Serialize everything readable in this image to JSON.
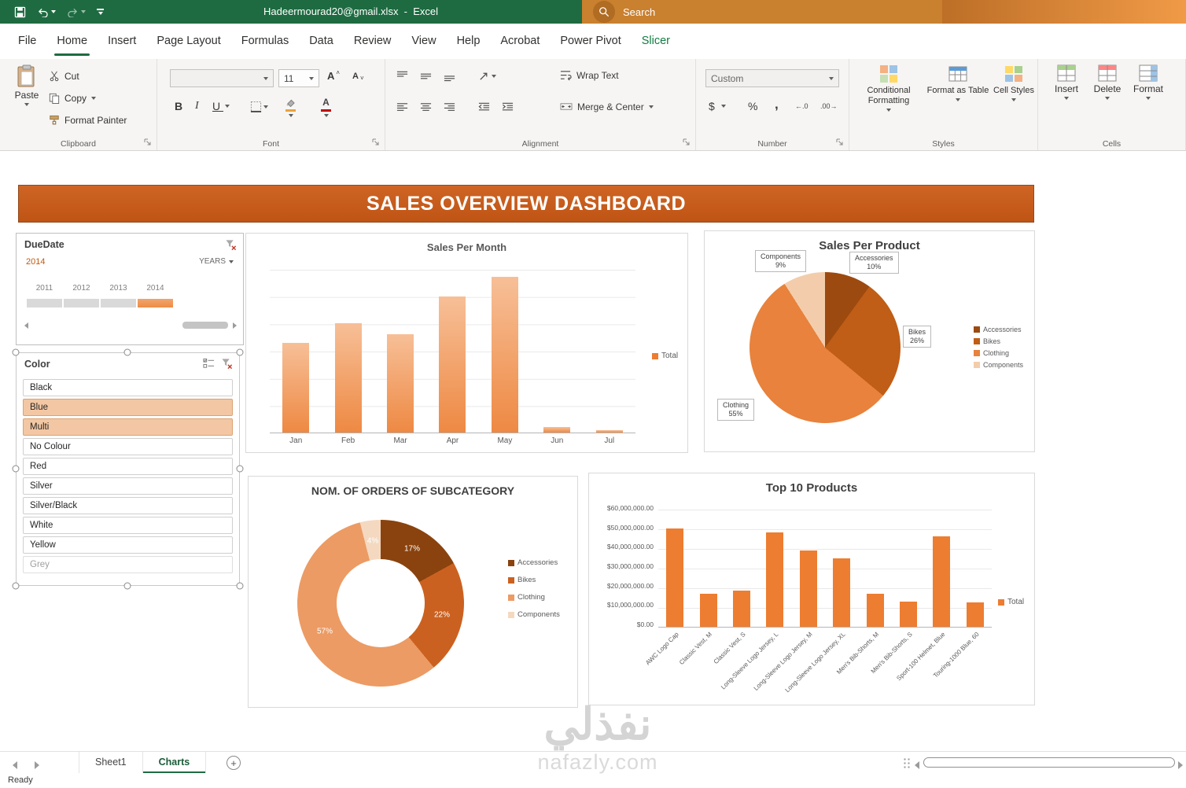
{
  "titlebar": {
    "filename": "Hadeermourad20@gmail.xlsx  -  Excel",
    "search_placeholder": "Search"
  },
  "ribbon": {
    "tabs": [
      "File",
      "Home",
      "Insert",
      "Page Layout",
      "Formulas",
      "Data",
      "Review",
      "View",
      "Help",
      "Acrobat",
      "Power Pivot",
      "Slicer"
    ],
    "active_tab": "Home",
    "contextual_tabs": [
      "Slicer"
    ],
    "clipboard": {
      "group_label": "Clipboard",
      "paste": "Paste",
      "cut": "Cut",
      "copy": "Copy",
      "format_painter": "Format Painter"
    },
    "font": {
      "group_label": "Font",
      "font_name": "",
      "font_size": "11"
    },
    "alignment": {
      "group_label": "Alignment",
      "wrap_text": "Wrap Text",
      "merge_center": "Merge & Center"
    },
    "number": {
      "group_label": "Number",
      "format": "Custom",
      "increase_decimal": "←.0",
      "decrease_decimal": ".00→"
    },
    "styles": {
      "group_label": "Styles",
      "conditional": "Conditional Formatting",
      "format_table": "Format as Table",
      "cell_styles": "Cell Styles"
    },
    "cells": {
      "group_label": "Cells",
      "insert": "Insert",
      "delete": "Delete",
      "format": "Format"
    }
  },
  "dashboard_title": "SALES OVERVIEW DASHBOARD",
  "timeline": {
    "title": "DueDate",
    "selection": "2014",
    "period_selector": "YEARS",
    "years": [
      "2011",
      "2012",
      "2013",
      "2014"
    ],
    "selected_year": "2014"
  },
  "color_slicer": {
    "title": "Color",
    "items": [
      {
        "label": "Black",
        "state": "normal"
      },
      {
        "label": "Blue",
        "state": "selected"
      },
      {
        "label": "Multi",
        "state": "selected"
      },
      {
        "label": "No Colour",
        "state": "normal"
      },
      {
        "label": "Red",
        "state": "normal"
      },
      {
        "label": "Silver",
        "state": "normal"
      },
      {
        "label": "Silver/Black",
        "state": "normal"
      },
      {
        "label": "White",
        "state": "normal"
      },
      {
        "label": "Yellow",
        "state": "normal"
      },
      {
        "label": "Grey",
        "state": "disabled"
      }
    ]
  },
  "chart_data": [
    {
      "type": "bar",
      "title": "Sales Per Month",
      "categories": [
        "Jan",
        "Feb",
        "Mar",
        "Apr",
        "May",
        "Jun",
        "Jul"
      ],
      "series": [
        {
          "name": "Total",
          "values": [
            33,
            40,
            36,
            50,
            57,
            2,
            1
          ]
        }
      ],
      "ylim": [
        0,
        60
      ],
      "grid": true,
      "legend": [
        "Total"
      ],
      "legend_position": "right",
      "bar_color": "#ed7d31",
      "note": "y-axis has gridlines but no visible tick labels"
    },
    {
      "type": "pie",
      "title": "Sales Per Product",
      "labels": [
        "Accessories",
        "Bikes",
        "Clothing",
        "Components"
      ],
      "values": [
        10,
        26,
        55,
        9
      ],
      "pct": [
        "10%",
        "26%",
        "55%",
        "9%"
      ],
      "colors": [
        "#9c4a10",
        "#c05d16",
        "#e8823c",
        "#f3cdab"
      ],
      "legend_position": "right"
    },
    {
      "type": "donut",
      "title": "NOM. OF ORDERS OF SUBCATEGORY",
      "labels": [
        "Accessories",
        "Bikes",
        "Clothing",
        "Components"
      ],
      "values": [
        17,
        22,
        57,
        4
      ],
      "pct": [
        "17%",
        "22%",
        "57%",
        "4%"
      ],
      "colors": [
        "#8a430e",
        "#cb6120",
        "#ec9b64",
        "#f4d9c0"
      ],
      "legend_position": "right"
    },
    {
      "type": "bar",
      "title": "Top 10 Products",
      "categories": [
        "AWC Logo Cap",
        "Classic Vest, M",
        "Classic Vest, S",
        "Long-Sleeve Logo Jersey, L",
        "Long-Sleeve Logo Jersey, M",
        "Long-Sleeve Logo Jersey, XL",
        "Men's Bib-Shorts, M",
        "Men's Bib-Shorts, S",
        "Sport-100 Helmet, Blue",
        "Touring-1000 Blue, 60"
      ],
      "series": [
        {
          "name": "Total",
          "values": [
            50000000,
            17000000,
            18500000,
            48000000,
            39000000,
            35000000,
            17000000,
            13000000,
            46000000,
            12500000
          ]
        }
      ],
      "ylim": [
        0,
        60000000
      ],
      "yticks": [
        "$60,000,000.00",
        "$50,000,000.00",
        "$40,000,000.00",
        "$30,000,000.00",
        "$20,000,000.00",
        "$10,000,000.00",
        "$0.00"
      ],
      "grid": true,
      "legend": [
        "Total"
      ],
      "legend_position": "right",
      "bar_color": "#ed7d31"
    }
  ],
  "sheet_tabs": {
    "tabs": [
      {
        "name": "Sheet1",
        "active": false
      },
      {
        "name": "Charts",
        "active": true
      }
    ]
  },
  "status_bar": "Ready",
  "watermark": {
    "line1": "نفذلي",
    "line2": "nafazly.com"
  },
  "colors": {
    "excel_green": "#1e6b41",
    "accent_orange": "#ed7d31",
    "banner_orange": "#c4591b",
    "selected_item": "#f3c7a3",
    "contextual_tab_green": "#107c41"
  }
}
